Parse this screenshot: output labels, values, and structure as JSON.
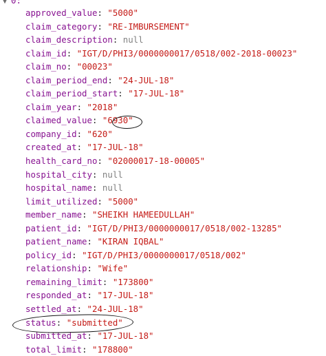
{
  "root": {
    "toggle_icon": "triangle-down",
    "index_label": "0:"
  },
  "rows": [
    {
      "key": "approved_value",
      "value": "\"5000\"",
      "kind": "string"
    },
    {
      "key": "claim_category",
      "value": "\"RE-IMBURSEMENT\"",
      "kind": "string"
    },
    {
      "key": "claim_description",
      "value": "null",
      "kind": "null"
    },
    {
      "key": "claim_id",
      "value": "\"IGT/D/PHI3/0000000017/0518/002-2018-00023\"",
      "kind": "string"
    },
    {
      "key": "claim_no",
      "value": "\"00023\"",
      "kind": "string"
    },
    {
      "key": "claim_period_end",
      "value": "\"24-JUL-18\"",
      "kind": "string"
    },
    {
      "key": "claim_period_start",
      "value": "\"17-JUL-18\"",
      "kind": "string"
    },
    {
      "key": "claim_year",
      "value": "\"2018\"",
      "kind": "string"
    },
    {
      "key": "claimed_value",
      "value": "\"6930\"",
      "kind": "string"
    },
    {
      "key": "company_id",
      "value": "\"620\"",
      "kind": "string"
    },
    {
      "key": "created_at",
      "value": "\"17-JUL-18\"",
      "kind": "string"
    },
    {
      "key": "health_card_no",
      "value": "\"02000017-18-00005\"",
      "kind": "string"
    },
    {
      "key": "hospital_city",
      "value": "null",
      "kind": "null"
    },
    {
      "key": "hospital_name",
      "value": "null",
      "kind": "null"
    },
    {
      "key": "limit_utilized",
      "value": "\"5000\"",
      "kind": "string"
    },
    {
      "key": "member_name",
      "value": "\"SHEIKH HAMEEDULLAH\"",
      "kind": "string"
    },
    {
      "key": "patient_id",
      "value": "\"IGT/D/PHI3/0000000017/0518/002-13285\"",
      "kind": "string"
    },
    {
      "key": "patient_name",
      "value": "\"KIRAN IQBAL\"",
      "kind": "string"
    },
    {
      "key": "policy_id",
      "value": "\"IGT/D/PHI3/0000000017/0518/002\"",
      "kind": "string"
    },
    {
      "key": "relationship",
      "value": "\"Wife\"",
      "kind": "string"
    },
    {
      "key": "remaining_limit",
      "value": "\"173800\"",
      "kind": "string"
    },
    {
      "key": "responded_at",
      "value": "\"17-JUL-18\"",
      "kind": "string"
    },
    {
      "key": "settled_at",
      "value": "\"24-JUL-18\"",
      "kind": "string"
    },
    {
      "key": "status",
      "value": "\"submitted\"",
      "kind": "string"
    },
    {
      "key": "submitted_at",
      "value": "\"17-JUL-18\"",
      "kind": "string"
    },
    {
      "key": "total_limit",
      "value": "\"178800\"",
      "kind": "string"
    }
  ],
  "colors": {
    "key": "#881391",
    "string": "#c41a16",
    "null": "#808080",
    "annotation": "#111111"
  }
}
